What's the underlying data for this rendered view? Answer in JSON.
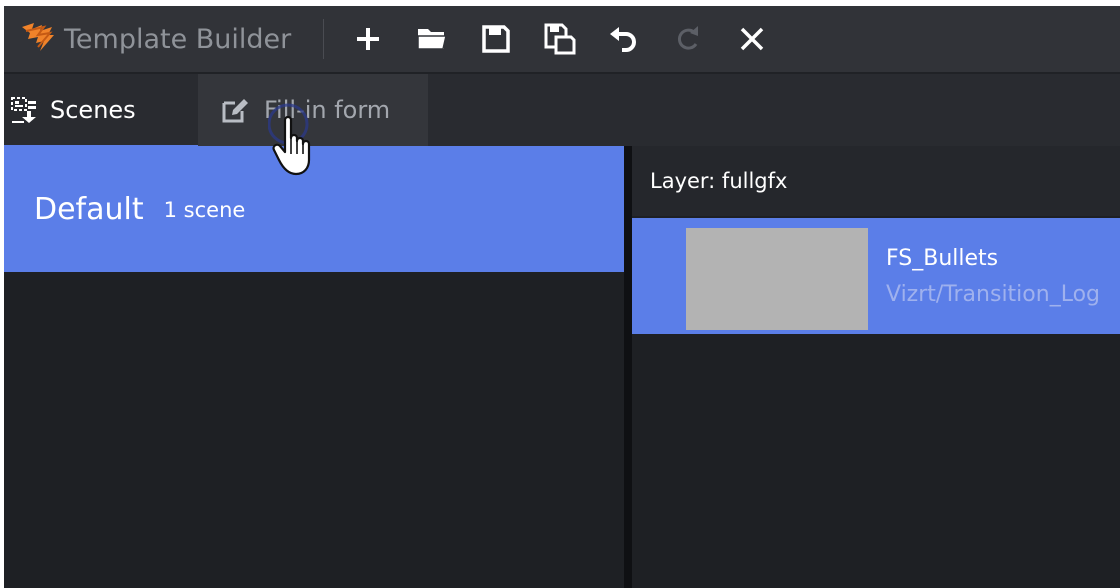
{
  "app": {
    "title": "Template Builder"
  },
  "toolbar": {
    "buttons": [
      {
        "name": "new-button",
        "icon": "plus-icon",
        "enabled": true
      },
      {
        "name": "open-button",
        "icon": "folder-icon",
        "enabled": true
      },
      {
        "name": "save-button",
        "icon": "save-icon",
        "enabled": true
      },
      {
        "name": "save-as-button",
        "icon": "save-as-icon",
        "enabled": true
      },
      {
        "name": "undo-button",
        "icon": "undo-icon",
        "enabled": true
      },
      {
        "name": "redo-button",
        "icon": "redo-icon",
        "enabled": false
      },
      {
        "name": "close-button",
        "icon": "close-icon",
        "enabled": true
      }
    ]
  },
  "tabs": {
    "scenes": {
      "label": "Scenes",
      "icon": "scenes-icon",
      "active": true
    },
    "fill_in_form": {
      "label": "Fill-in form",
      "icon": "edit-form-icon",
      "active": false
    }
  },
  "scene_groups": [
    {
      "name": "Default",
      "count": "1 scene",
      "selected": true
    }
  ],
  "layer": {
    "label": "Layer: fullgfx",
    "scenes": [
      {
        "name": "FS_Bullets",
        "path": "Vizrt/Transition_Log",
        "selected": true
      }
    ]
  },
  "colors": {
    "accent": "#5b7ee8",
    "background": "#1f2126",
    "toolbar": "#313338",
    "logo_orange": "#f0832a"
  }
}
